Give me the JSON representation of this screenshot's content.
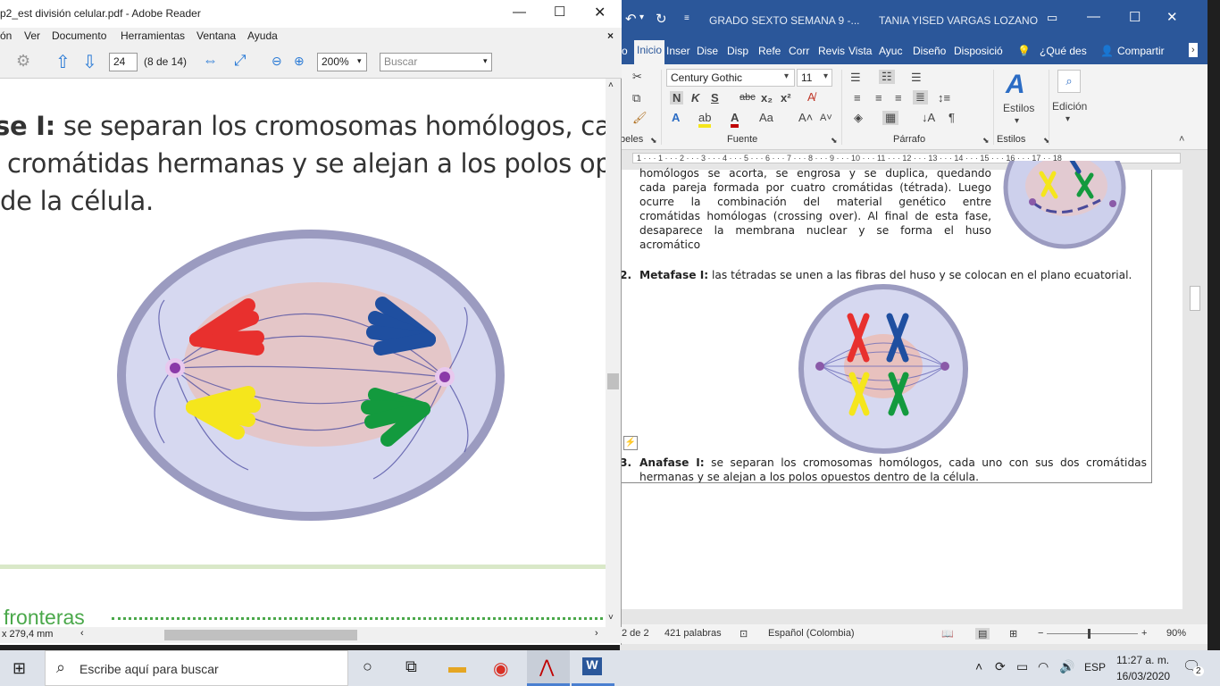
{
  "adobe": {
    "title": "p2_est división celular.pdf - Adobe Reader",
    "menu": [
      "ón",
      "Ver",
      "Documento",
      "Herramientas",
      "Ventana",
      "Ayuda"
    ],
    "page_number": "24",
    "page_count": "(8 de 14)",
    "zoom": "200%",
    "search_placeholder": "Buscar",
    "text_line1_bold": "se I:",
    "text_line1_rest": " se separan los cromosomas homólogos, cada u",
    "text_line2": "cromátidas hermanas y se alejan a los polos opues",
    "text_line3": "de la célula.",
    "footer_word": "fronteras",
    "page_size": "x 279,4 mm"
  },
  "word": {
    "title_doc": "GRADO SEXTO SEMANA 9  -...",
    "user_name": "TANIA YISED VARGAS LOZANO",
    "tabs": [
      "o",
      "Inicio",
      "Inser",
      "Dise",
      "Disp",
      "Refe",
      "Corr",
      "Revis",
      "Vista",
      "Ayuc",
      "Diseño",
      "Disposició"
    ],
    "tell_me": "¿Qué des",
    "share": "Compartir",
    "font_name": "Century Gothic",
    "font_size": "11",
    "group_labels": [
      "beles",
      "Fuente",
      "Párrafo",
      "Estilos"
    ],
    "styles_label": "Estilos",
    "editing_label": "Edición",
    "ruler": "1 · · · 1 · · · 2 · · · 3 · · · 4 · · · 5 · · · 6 · · · 7 · · · 8 · · · 9 · · · 10 · · · 11 · · · 12 · · · 13 · · · 14 · · · 15 · · · 16 · · · 17 · · 18",
    "prophase_lines": [
      "homólogos se acorta, se engrosa y se duplica, quedando",
      "cada pareja formada por cuatro cromátidas (tétrada). Luego",
      "ocurre   la   combinación   del   material   genético   entre",
      "cromátidas homólogas (crossing over). Al final de esta fase,",
      "desaparece  la  membrana  nuclear  y  se  forma  el  huso",
      "acromático"
    ],
    "item2_num": "2.",
    "item2_bold": "Metafase I:",
    "item2_text": " las tétradas se unen a las fibras del huso y se colocan en el plano ecuatorial.",
    "item3_num": "3.",
    "item3_bold": "Anafase I:",
    "item3_text": " se separan los cromosomas homólogos, cada uno con sus dos cromátidas",
    "item3_line2": "hermanas y se alejan a los polos opuestos dentro de la célula.",
    "status_page": "2 de 2",
    "status_words": "421 palabras",
    "status_lang": "Español (Colombia)",
    "zoom": "90%"
  },
  "taskbar": {
    "search_placeholder": "Escribe aquí para buscar",
    "lang": "ESP",
    "time": "11:27 a. m.",
    "date": "16/03/2020",
    "notifications": "2"
  },
  "colors": {
    "word_blue": "#2b579a",
    "chrom_red": "#e8302e",
    "chrom_blue": "#1f4fa0",
    "chrom_yellow": "#f5e61c",
    "chrom_green": "#139a3e",
    "cell_border": "#9b9bc0",
    "cell_fill": "#d6d8f0"
  }
}
